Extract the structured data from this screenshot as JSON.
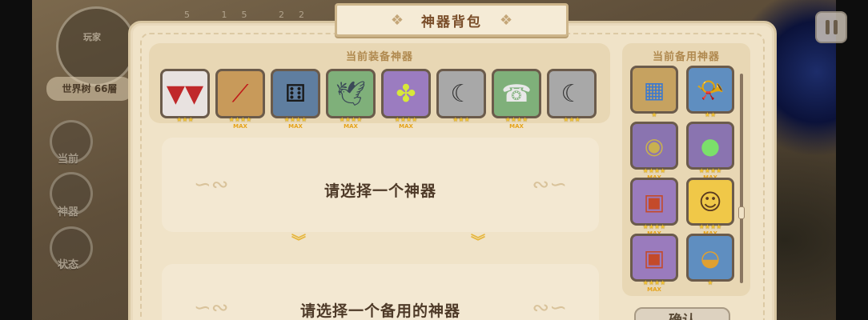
{
  "dialog": {
    "title": "神器背包"
  },
  "equipped": {
    "title": "当前装备神器",
    "slots": [
      {
        "icon": "toothed-jaw-icon",
        "stars": "★★★",
        "max": ""
      },
      {
        "icon": "red-katana-icon",
        "stars": "★★★★",
        "max": "MAX"
      },
      {
        "icon": "black-dice-icon",
        "stars": "★★★★",
        "max": "MAX"
      },
      {
        "icon": "pigeon-icon",
        "stars": "★★★★",
        "max": "MAX"
      },
      {
        "icon": "four-leaf-clover-icon",
        "stars": "★★★★",
        "max": "MAX"
      },
      {
        "icon": "curved-blade-icon",
        "stars": "★★★",
        "max": ""
      },
      {
        "icon": "phone-icon",
        "stars": "★★★★",
        "max": "MAX"
      },
      {
        "icon": "curved-blade-icon",
        "stars": "★★★",
        "max": ""
      }
    ]
  },
  "select_primary": "请选择一个神器",
  "select_backup": "请选择一个备用的神器",
  "backup": {
    "title": "当前备用神器",
    "slots": [
      {
        "icon": "pixel-cube-icon",
        "stars": "★",
        "max": ""
      },
      {
        "icon": "horn-icon",
        "stars": "★★",
        "max": ""
      },
      {
        "icon": "gold-coin-icon",
        "stars": "★★★★",
        "max": "MAX"
      },
      {
        "icon": "green-slime-icon",
        "stars": "★★★★",
        "max": "MAX"
      },
      {
        "icon": "portrait-card-icon",
        "stars": "★★★★",
        "max": "MAX"
      },
      {
        "icon": "blonde-girl-icon",
        "stars": "★★★★",
        "max": "MAX"
      },
      {
        "icon": "portrait-card-icon",
        "stars": "★★★★",
        "max": "MAX"
      },
      {
        "icon": "golden-bowl-icon",
        "stars": "★",
        "max": ""
      }
    ],
    "confirm_label": "确认"
  },
  "background": {
    "minimap_title": "玩家",
    "minimap_tag": "世界树 66層",
    "side_buttons": [
      "当前",
      "神器",
      "状态"
    ],
    "top_numbers": "5 15 22 5"
  }
}
